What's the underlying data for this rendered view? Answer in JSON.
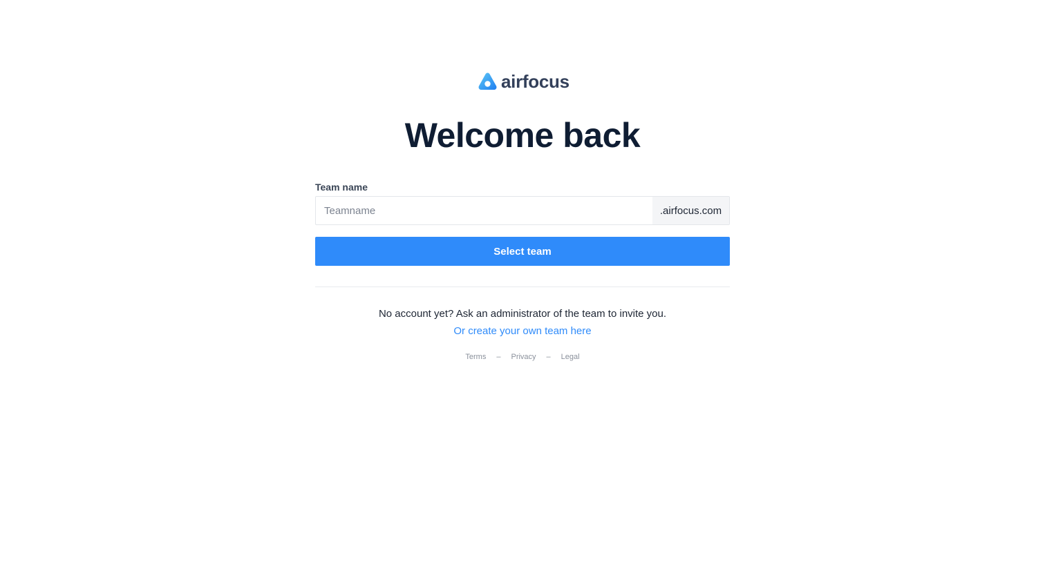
{
  "brand": {
    "name": "airfocus",
    "colors": {
      "logo_light": "#5ec8f5",
      "logo_dark": "#1f7ef0",
      "text": "#33405a"
    }
  },
  "heading": "Welcome back",
  "form": {
    "label": "Team name",
    "input": {
      "value": "",
      "placeholder": "Teamname"
    },
    "suffix": ".airfocus.com",
    "submit_label": "Select team"
  },
  "signup": {
    "prompt": "No account yet? Ask an administrator of the team to invite you.",
    "create_link": "Or create your own team here"
  },
  "footer": {
    "links": [
      "Terms",
      "Privacy",
      "Legal"
    ],
    "separator": "–"
  },
  "theme": {
    "accent": "#2f8bfa",
    "heading_color": "#0f1d33"
  }
}
